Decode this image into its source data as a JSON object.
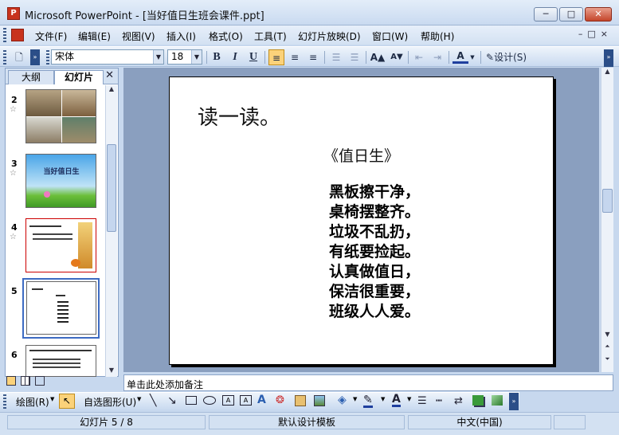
{
  "window": {
    "title": "Microsoft PowerPoint - [当好值日生班会课件.ppt]",
    "app_icon_letter": "P",
    "buttons": [
      "─",
      "□",
      "✕"
    ]
  },
  "menu": [
    "文件(F)",
    "编辑(E)",
    "视图(V)",
    "插入(I)",
    "格式(O)",
    "工具(T)",
    "幻灯片放映(D)",
    "窗口(W)",
    "帮助(H)"
  ],
  "toolbar": {
    "font_name": "宋体",
    "font_size": "18",
    "bold": "B",
    "italic": "I",
    "underline": "U",
    "design_label": "设计(S)"
  },
  "left_pane": {
    "tabs": [
      "大纲",
      "幻灯片"
    ],
    "close": "✕",
    "thumbs": [
      {
        "num": "2",
        "has_star": true
      },
      {
        "num": "3",
        "has_star": true,
        "text": "当好值日生"
      },
      {
        "num": "4",
        "has_star": true
      },
      {
        "num": "5",
        "has_star": false,
        "selected": true
      },
      {
        "num": "6",
        "has_star": false
      }
    ]
  },
  "slide": {
    "heading": "读一读。",
    "poem_title": "《值日生》",
    "poem_lines": [
      "黑板擦干净，",
      "桌椅摆整齐。",
      "垃圾不乱扔，",
      "有纸要捡起。",
      "认真做值日，",
      "保洁很重要，",
      "班级人人爱。"
    ]
  },
  "notes_placeholder": "单击此处添加备注",
  "draw": {
    "draw_label": "绘图(R)",
    "autoshapes_label": "自选图形(U)"
  },
  "status": {
    "slide_info": "幻灯片 5 / 8",
    "template": "默认设计模板",
    "language": "中文(中国)"
  }
}
